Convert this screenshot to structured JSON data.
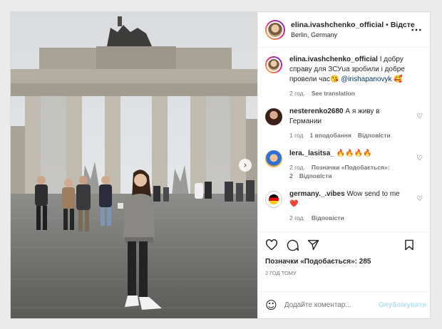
{
  "post": {
    "author": "elina.ivashchenko_official",
    "separator": "•",
    "follow_label": "Відсте",
    "location": "Berlin, Germany",
    "more_icon": "more-dots-icon"
  },
  "caption": {
    "author": "elina.ivashchenko_official",
    "text": " I добру справу для ЗСУua зробили і добре провели час",
    "emoji1": "😘",
    "mention": "@irishapanovyk",
    "emoji2": "🥰",
    "time": "2 год.",
    "translation": "See translation"
  },
  "comments": [
    {
      "author": "nesterenko2680",
      "text": " А я живу в Германии",
      "time": "1 год",
      "likes": "1 вподобання",
      "reply": "Відповісти"
    },
    {
      "author": "lera._lasitsa_",
      "text": " 🔥🔥🔥🔥",
      "time": "2 год.",
      "likes": "Позначки «Подобається»: 2",
      "reply": "Відповісти"
    },
    {
      "author": "germany._.vibes",
      "text": " Wow send to me",
      "emoji": "❤️",
      "time": "2 год.",
      "reply": "Відповісти"
    }
  ],
  "actions": {
    "likes_text": "Позначки «Подобається»: 285",
    "time_ago": "2 год тому"
  },
  "add_comment": {
    "emoji_icon": "☺",
    "placeholder": "Додайте коментар...",
    "post_label": "Опублікувати"
  },
  "carousel": {
    "next_glyph": "›"
  },
  "colors": {
    "link": "#00376b",
    "muted": "#737373",
    "post_button": "#b2dffc"
  }
}
